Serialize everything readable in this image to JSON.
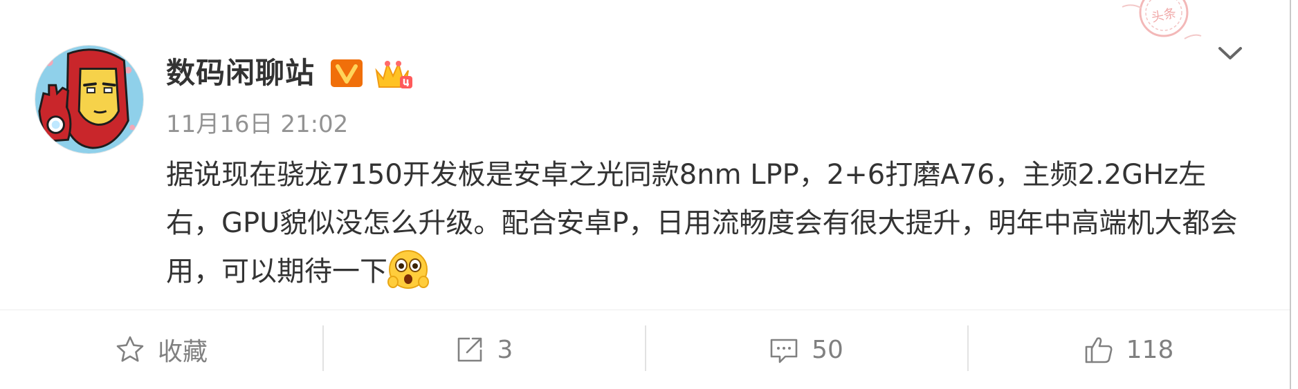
{
  "post": {
    "username": "数码闲聊站",
    "timestamp": "11月16日 21:02",
    "text": "据说现在骁龙7150开发板是安卓之光同款8nm LPP，2+6打磨A76，主频2.2GHz左右，GPU貌似没怎么升级。配合安卓P，日用流畅度会有很大提升，明年中高端机大都会用，可以期待一下",
    "emoji": "surprised-face-emoji",
    "stamp_text": "头条"
  },
  "actions": {
    "favorite_label": "收藏",
    "repost_count": "3",
    "comment_count": "50",
    "like_count": "118"
  },
  "icons": {
    "verify": "verified-v-icon",
    "level": "crown-level-icon",
    "menu": "chevron-down-icon",
    "favorite": "star-icon",
    "repost": "share-icon",
    "comment": "comment-icon",
    "like": "thumbs-up-icon"
  },
  "colors": {
    "verify_orange": "#f06f0a",
    "crown_yellow": "#ffc223",
    "text_primary": "#333333",
    "text_secondary": "#939393"
  }
}
